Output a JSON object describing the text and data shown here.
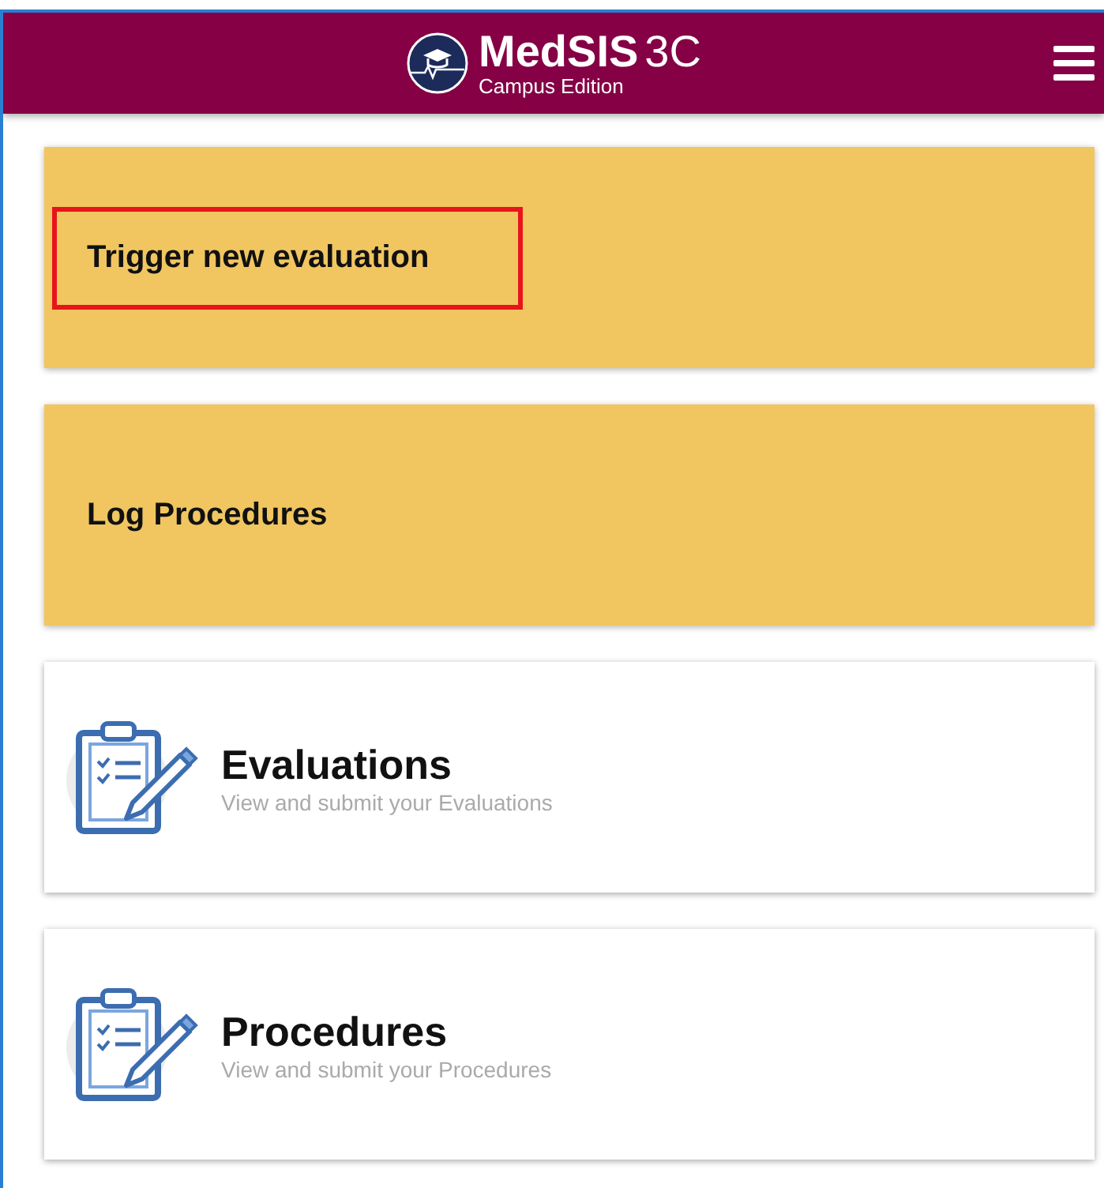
{
  "header": {
    "brand": "MedSIS",
    "version": "3C",
    "edition": "Campus Edition"
  },
  "actions": [
    {
      "label": "Trigger new evaluation",
      "highlighted": true
    },
    {
      "label": "Log Procedures",
      "highlighted": false
    }
  ],
  "modules": [
    {
      "title": "Evaluations",
      "subtitle": "View and submit your Evaluations"
    },
    {
      "title": "Procedures",
      "subtitle": "View and submit your Procedures"
    }
  ]
}
